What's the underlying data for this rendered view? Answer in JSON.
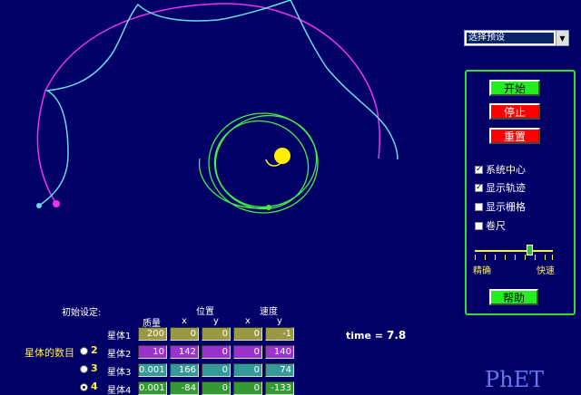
{
  "preset": {
    "selected": "选择预设"
  },
  "controls": {
    "start": "开始",
    "stop": "停止",
    "reset": "重置",
    "help": "帮助",
    "checkboxes": [
      {
        "label": "系统中心",
        "checked": true
      },
      {
        "label": "显示轨迹",
        "checked": true
      },
      {
        "label": "显示栅格",
        "checked": false
      },
      {
        "label": "卷尺",
        "checked": false
      }
    ],
    "speed": {
      "low_label": "精确",
      "high_label": "快速",
      "level": 0.8
    }
  },
  "settings": {
    "title": "初始设定:",
    "position_header": "位置",
    "velocity_header": "速度",
    "mass_header": "质量",
    "x_header": "x",
    "y_header": "y",
    "body_count_label": "星体的数目",
    "body_count_options": [
      "2",
      "3",
      "4"
    ],
    "body_count_selected": "4",
    "bodies": [
      {
        "name": "星体1",
        "mass": "200",
        "x": "0",
        "y": "0",
        "vx": "0",
        "vy": "-1",
        "color": "#999944"
      },
      {
        "name": "星体2",
        "mass": "10",
        "x": "142",
        "y": "0",
        "vx": "0",
        "vy": "140",
        "color": "#9933cc"
      },
      {
        "name": "星体3",
        "mass": "0.001",
        "x": "166",
        "y": "0",
        "vx": "0",
        "vy": "74",
        "color": "#339999"
      },
      {
        "name": "星体4",
        "mass": "0.001",
        "x": "-84",
        "y": "0",
        "vx": "0",
        "vy": "-133",
        "color": "#339933"
      }
    ]
  },
  "time": {
    "label": "time =",
    "value": "7.8"
  },
  "logo": "PhET",
  "colors": {
    "background": "#000066",
    "sun": "#ffee00",
    "planet_magenta": "#ee33ee",
    "trail_cyan": "#66ddee",
    "trail_green": "#44ee44",
    "panel_border": "#33dd33"
  },
  "icons": [
    "dropdown-arrow-icon",
    "checkbox-icon",
    "radio-icon",
    "slider-thumb-icon"
  ]
}
